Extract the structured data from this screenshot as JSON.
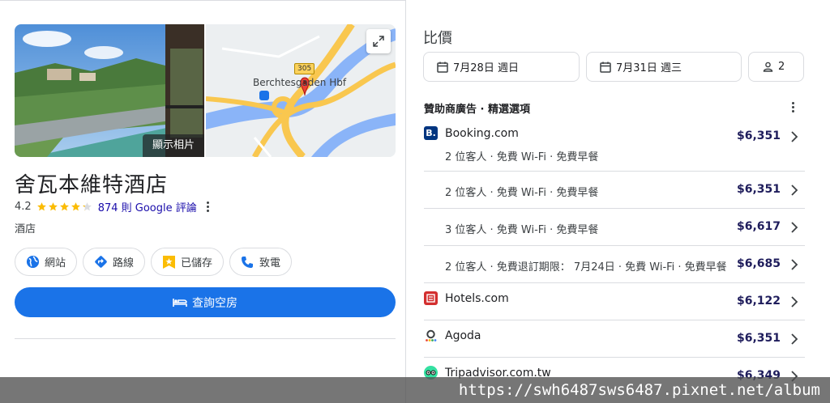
{
  "hotel": {
    "photo_label": "顯示相片",
    "map_road_number": "305",
    "map_station_label": "Berchtesgaden Hbf",
    "name": "舍瓦本維特酒店",
    "rating": "4.2",
    "review_count": "874 則 Google 評論",
    "category": "酒店",
    "stars_filled": 4.2,
    "actions": [
      {
        "label": "網站",
        "icon": "globe-icon"
      },
      {
        "label": "路線",
        "icon": "directions-icon"
      },
      {
        "label": "已儲存",
        "icon": "bookmark-icon"
      },
      {
        "label": "致電",
        "icon": "phone-icon"
      }
    ],
    "book_label": "查詢空房"
  },
  "compare": {
    "title": "比價",
    "checkin": "7月28日 週日",
    "checkout": "7月31日 週三",
    "guests": "2",
    "sponsored_label": "贊助商廣告 · 精選選項"
  },
  "offers": [
    {
      "provider": "Booking.com",
      "detail": "2 位客人 · 免費 Wi-Fi · 免費早餐",
      "price": "$6,351"
    },
    {
      "provider": "",
      "detail": "2 位客人 · 免費 Wi-Fi · 免費早餐",
      "price": "$6,351"
    },
    {
      "provider": "",
      "detail": "3 位客人 · 免費 Wi-Fi · 免費早餐",
      "price": "$6,617"
    },
    {
      "provider": "",
      "detail": "2 位客人 · 免費退訂期限： 7月24日 · 免費 Wi-Fi · 免費早餐",
      "price": "$6,685"
    },
    {
      "provider": "Hotels.com",
      "detail": "",
      "price": "$6,122"
    },
    {
      "provider": "Agoda",
      "detail": "",
      "price": "$6,351"
    },
    {
      "provider": "Tripadvisor.com.tw",
      "detail": "",
      "price": "$6,349"
    }
  ],
  "watermark": "https://swh6487sws6487.pixnet.net/album",
  "colors": {
    "primary": "#1a73e8",
    "price": "#1f1d5c",
    "star": "#fbbc04",
    "booking": "#003580",
    "hotels": "#d32f2f",
    "tripadvisor": "#34e0a1"
  }
}
